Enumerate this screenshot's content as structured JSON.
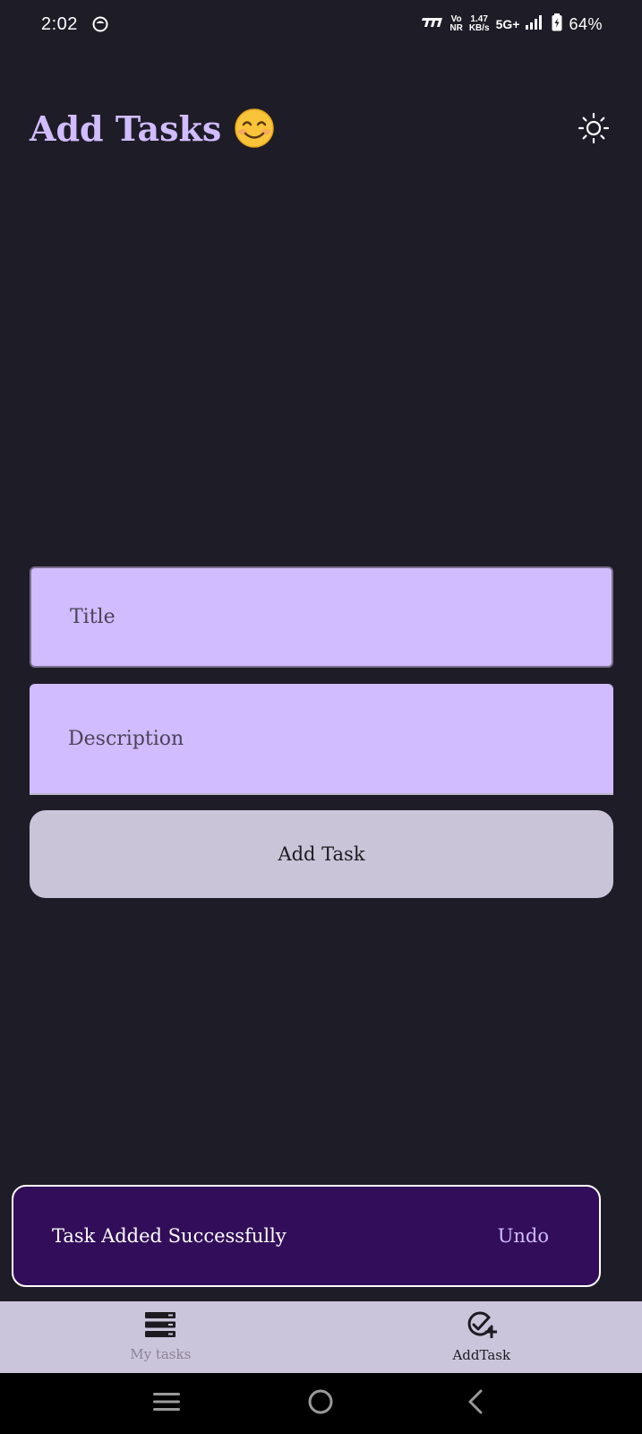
{
  "status_bar": {
    "time": "2:02",
    "vo_top": "Vo",
    "vo_bottom": "NR",
    "speed_top": "1.47",
    "speed_bottom": "KB/s",
    "network": "5G+",
    "battery": "64%"
  },
  "header": {
    "title": "Add Tasks",
    "emoji_icon": "smiling-face-icon",
    "theme_icon": "sun-icon"
  },
  "form": {
    "title_placeholder": "Title",
    "description_placeholder": "Description",
    "submit_label": "Add Task"
  },
  "snackbar": {
    "message": "Task Added Successfully",
    "action": "Undo"
  },
  "bottom_nav": {
    "items": [
      {
        "label": "My tasks",
        "icon": "list-icon",
        "active": false
      },
      {
        "label": "AddTask",
        "icon": "check-circle-plus-icon",
        "active": true
      }
    ]
  },
  "system_nav": {
    "icons": [
      "menu-icon",
      "home-icon",
      "back-icon"
    ]
  },
  "colors": {
    "background": "#1e1c26",
    "accent": "#d0bcff",
    "snackbar": "#320e5a",
    "nav_bg": "#cbc5dc"
  }
}
